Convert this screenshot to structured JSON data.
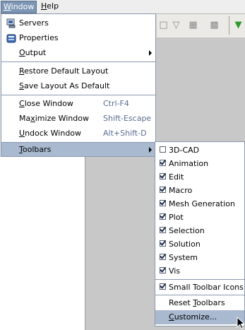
{
  "menubar": {
    "window_label": "Window",
    "window_mnemonic": "W",
    "window_rest": "indow",
    "help_label": "Help",
    "help_mnemonic": "H",
    "help_rest": "elp"
  },
  "window_menu": {
    "servers": "Servers",
    "properties": "Properties",
    "output_m": "O",
    "output_rest": "utput",
    "restore_m": "R",
    "restore_rest": "estore Default Layout",
    "save_m": "S",
    "save_rest": "ave Layout As Default",
    "close_m": "C",
    "close_rest": "lose Window",
    "close_acc": "Ctrl-F4",
    "maximize_pre": "Ma",
    "maximize_m": "x",
    "maximize_rest": "imize Window",
    "maximize_acc": "Shift-Escape",
    "undock_m": "U",
    "undock_rest": "ndock Window",
    "undock_acc": "Alt+Shift-D",
    "toolbars_m": "T",
    "toolbars_rest": "oolbars"
  },
  "toolbars_menu": {
    "items": [
      {
        "label": "3D-CAD",
        "checked": false
      },
      {
        "label": "Animation",
        "checked": true
      },
      {
        "label": "Edit",
        "checked": true
      },
      {
        "label": "Macro",
        "checked": true
      },
      {
        "label": "Mesh Generation",
        "checked": true
      },
      {
        "label": "Plot",
        "checked": true
      },
      {
        "label": "Selection",
        "checked": true
      },
      {
        "label": "Solution",
        "checked": true
      },
      {
        "label": "System",
        "checked": true
      },
      {
        "label": "Vis",
        "checked": true
      }
    ],
    "small_icons": "Small Toolbar Icons",
    "reset_pre": "Reset ",
    "reset_m": "T",
    "reset_rest": "oolbars",
    "customize_m": "C",
    "customize_rest": "ustomize..."
  },
  "colors": {
    "highlight": "#a8b9d0",
    "menu_border": "#8b99ad",
    "accelerator": "#5a6e90"
  }
}
